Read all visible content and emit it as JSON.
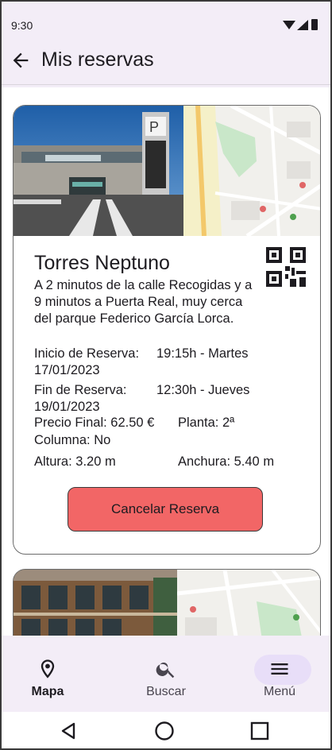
{
  "status": {
    "time": "9:30"
  },
  "header": {
    "title": "Mis reservas"
  },
  "reservation": {
    "name": "Torres Neptuno",
    "description": "A 2 minutos de la calle Recogidas y a 9 minutos a Puerta Real, muy cerca del parque Federico García Lorca.",
    "start_label": "Inicio de Reserva:",
    "start_value": "19:15h - Martes",
    "start_date": "17/01/2023",
    "end_label": "Fin de Reserva:",
    "end_value": "12:30h - Jueves",
    "end_date": "19/01/2023",
    "price": "Precio Final: 62.50 €",
    "floor": "Planta: 2ª",
    "column": "Columna: No",
    "height": "Altura: 3.20 m",
    "width": "Anchura: 5.40 m",
    "cancel_label": "Cancelar Reserva"
  },
  "nav": {
    "items": [
      {
        "label": "Mapa",
        "icon": "map-pin-icon",
        "active": true
      },
      {
        "label": "Buscar",
        "icon": "search-icon",
        "active": false
      },
      {
        "label": "Menú",
        "icon": "menu-icon",
        "active": false
      }
    ]
  },
  "colors": {
    "accent_bar": "#f3edf7",
    "cancel_button": "#f26666",
    "nav_indicator": "#e8def8"
  }
}
